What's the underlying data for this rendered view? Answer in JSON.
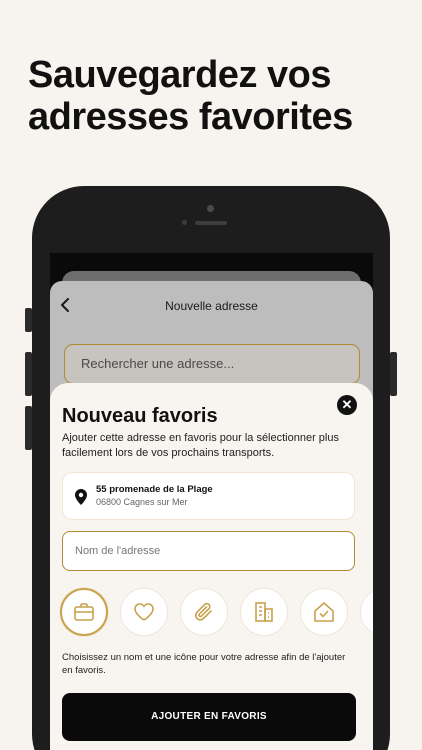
{
  "headline": {
    "line1": "Sauvegardez vos",
    "line2": "adresses favorites"
  },
  "underlying_sheet": {
    "back_icon": "chevron-left-icon",
    "title": "Nouvelle adresse",
    "search_placeholder": "Rechercher une adresse..."
  },
  "modal": {
    "title": "Nouveau favoris",
    "close_icon": "close-icon",
    "description": "Ajouter cette adresse en favoris pour la sélectionner plus facilement lors de vos prochains transports.",
    "address": {
      "icon": "map-pin-icon",
      "street": "55 promenade de la Plage",
      "city": "06800 Cagnes sur Mer"
    },
    "name_placeholder": "Nom de l'adresse",
    "icon_choices": [
      {
        "icon": "briefcase-icon",
        "selected": true
      },
      {
        "icon": "heart-icon",
        "selected": false
      },
      {
        "icon": "paperclip-icon",
        "selected": false
      },
      {
        "icon": "buildings-icon",
        "selected": false
      },
      {
        "icon": "house-check-icon",
        "selected": false
      },
      {
        "icon": "more-icon",
        "selected": false
      }
    ],
    "help_text": "Choisissez un nom et une icône pour votre adresse afin de l'ajouter en favoris.",
    "submit_label": "AJOUTER EN FAVORIS"
  },
  "colors": {
    "background": "#f7f3ee",
    "accent_gold": "#c9a24d",
    "button_black": "#0a0a0a",
    "modal_bg": "#f8f4ef"
  }
}
